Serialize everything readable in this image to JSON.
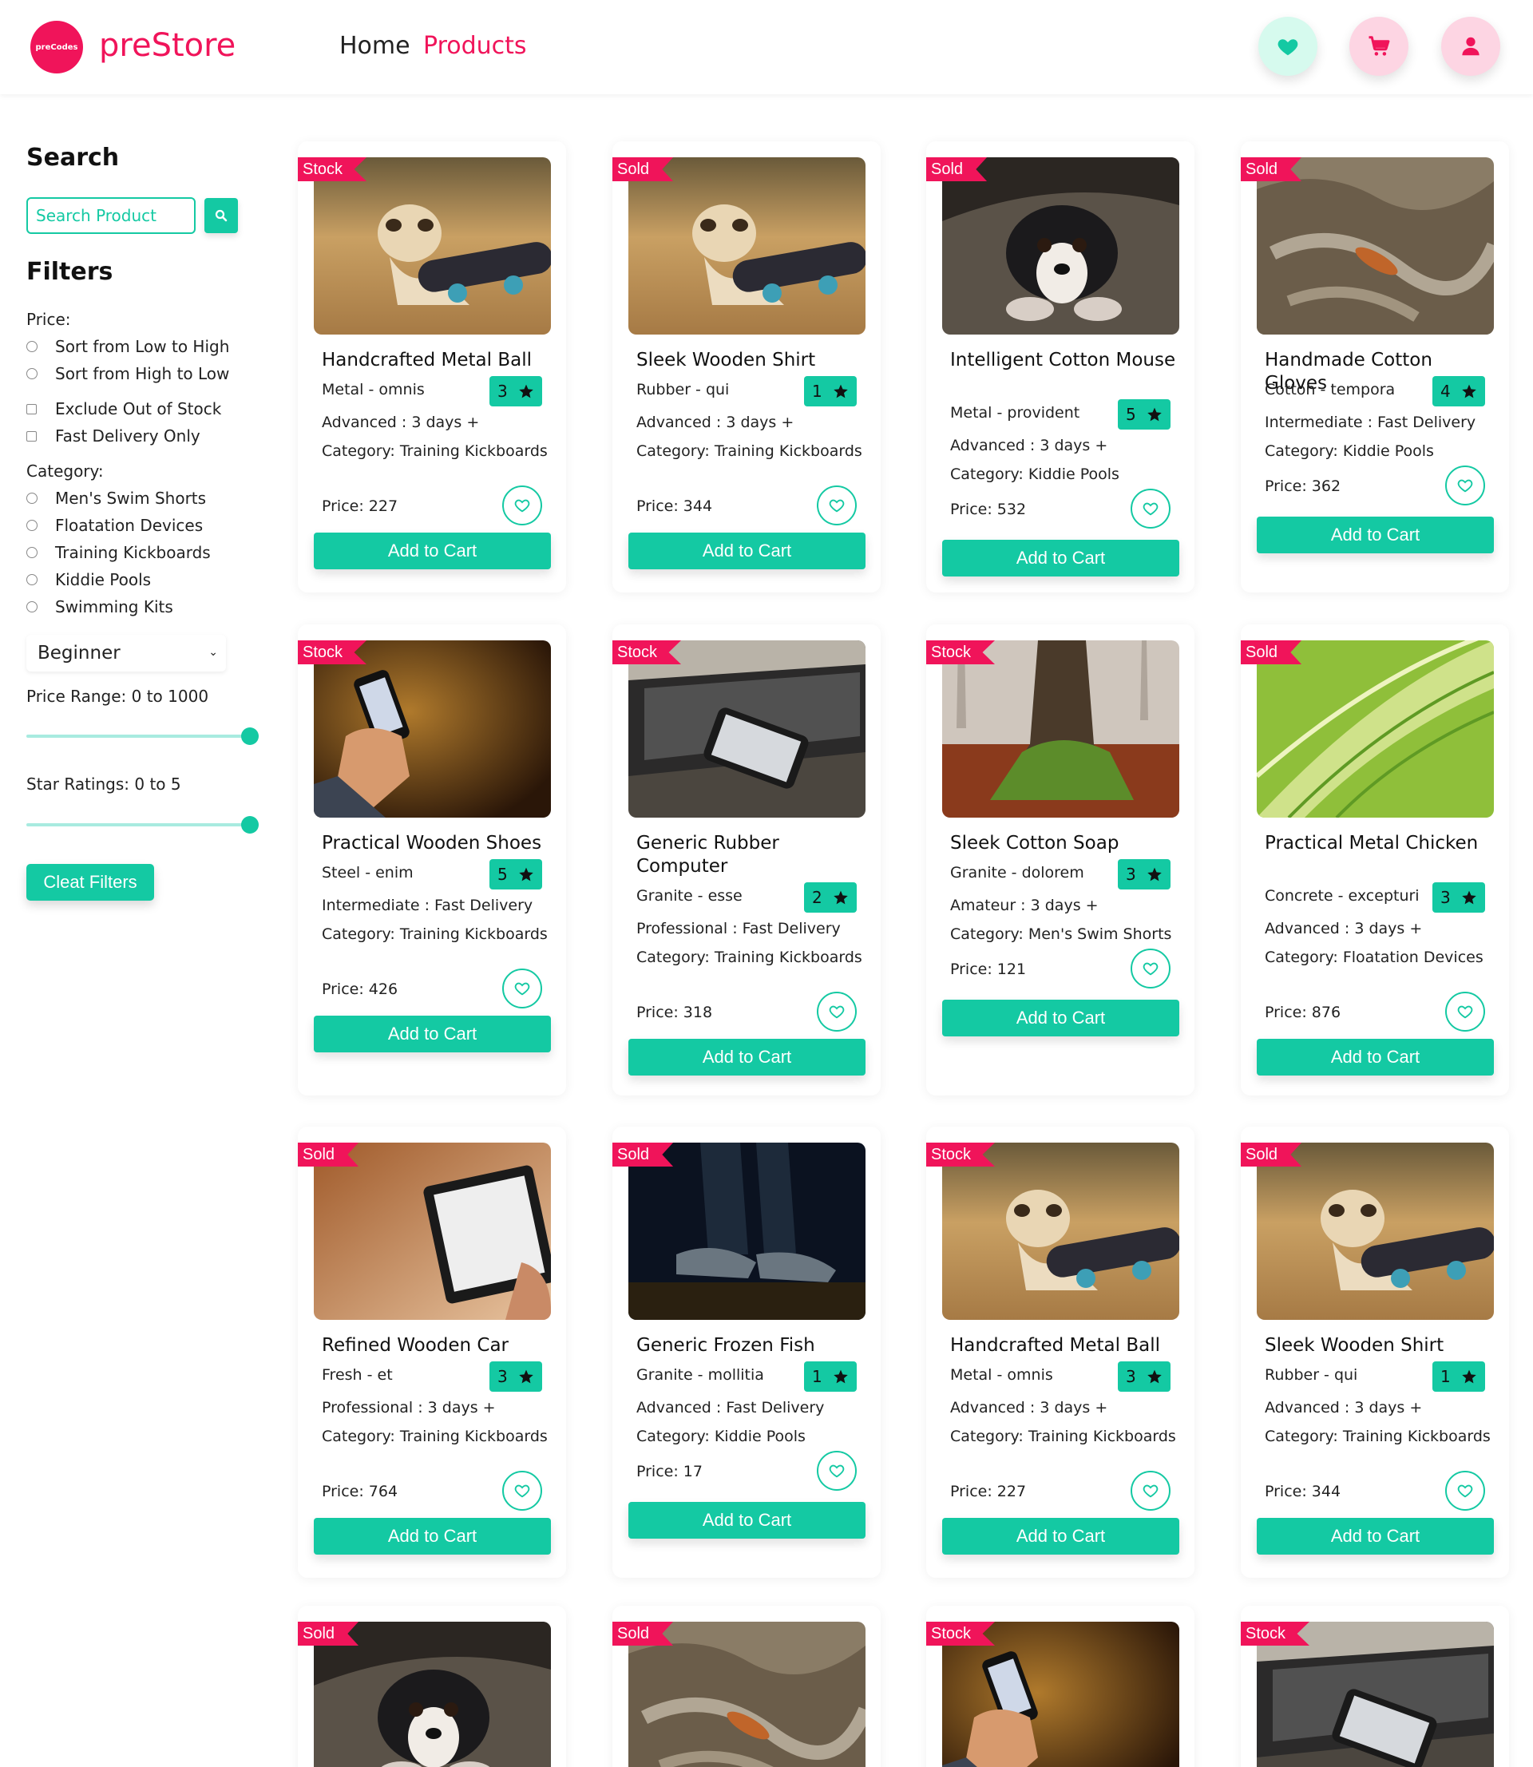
{
  "header": {
    "logo_badge": "preCodes",
    "brand": "preStore",
    "nav": {
      "home": "Home",
      "products": "Products"
    },
    "icons": [
      "heart-icon",
      "cart-icon",
      "user-icon"
    ],
    "colors": {
      "brand": "#f0145a",
      "accent": "#14c9a3"
    }
  },
  "sidebar": {
    "search_title": "Search",
    "search_placeholder": "Search Product",
    "filters_title": "Filters",
    "price_label": "Price:",
    "sort_options": [
      "Sort from Low to High",
      "Sort from High to Low"
    ],
    "checkboxes": [
      "Exclude Out of Stock",
      "Fast Delivery Only"
    ],
    "category_label": "Category:",
    "categories": [
      "Men's Swim Shorts",
      "Floatation Devices",
      "Training Kickboards",
      "Kiddie Pools",
      "Swimming Kits"
    ],
    "level_select": "Beginner",
    "price_range": "Price Range: 0 to 1000",
    "price_range_value": 1.0,
    "star_ratings": "Star Ratings: 0 to 5",
    "star_ratings_value": 1.0,
    "clear_button": "Cleat Filters"
  },
  "products": [
    {
      "badge": "Stock",
      "name": "Handcrafted Metal Ball",
      "material": "Metal - omnis",
      "rating": "3",
      "delivery": "Advanced : 3 days +",
      "category": "Category: Training Kickboards",
      "price": "Price: 227",
      "cart": "Add to Cart",
      "image": "dog"
    },
    {
      "badge": "Sold",
      "name": "Sleek Wooden Shirt",
      "material": "Rubber - qui",
      "rating": "1",
      "delivery": "Advanced : 3 days +",
      "category": "Category: Training Kickboards",
      "price": "Price: 344",
      "cart": "Add to Cart",
      "image": "dog"
    },
    {
      "badge": "Sold",
      "name": "Intelligent Cotton Mouse",
      "material": "Metal - provident",
      "rating": "5",
      "delivery": "Advanced : 3 days +",
      "category": "Category: Kiddie Pools",
      "price": "Price: 532",
      "cart": "Add to Cart",
      "image": "puppy"
    },
    {
      "badge": "Sold",
      "name": "Handmade Cotton Gloves",
      "material": "Cotton - tempora",
      "rating": "4",
      "delivery": "Intermediate : Fast Delivery",
      "category": "Category: Kiddie Pools",
      "price": "Price: 362",
      "cart": "Add to Cart",
      "image": "rock"
    },
    {
      "badge": "Stock",
      "name": "Practical Wooden Shoes",
      "material": "Steel - enim",
      "rating": "5",
      "delivery": "Intermediate : Fast Delivery",
      "category": "Category: Training Kickboards",
      "price": "Price: 426",
      "cart": "Add to Cart",
      "image": "phone"
    },
    {
      "badge": "Stock",
      "name": "Generic Rubber Computer",
      "material": "Granite - esse",
      "rating": "2",
      "delivery": "Professional : Fast Delivery",
      "category": "Category: Training Kickboards",
      "price": "Price: 318",
      "cart": "Add to Cart",
      "image": "laptop"
    },
    {
      "badge": "Stock",
      "name": "Sleek Cotton Soap",
      "material": "Granite - dolorem",
      "rating": "3",
      "delivery": "Amateur : 3 days +",
      "category": "Category: Men's Swim Shorts",
      "price": "Price: 121",
      "cart": "Add to Cart",
      "image": "tree"
    },
    {
      "badge": "Sold",
      "name": "Practical Metal Chicken",
      "material": "Concrete - excepturi",
      "rating": "3",
      "delivery": "Advanced : 3 days +",
      "category": "Category: Floatation Devices",
      "price": "Price: 876",
      "cart": "Add to Cart",
      "image": "leaf"
    },
    {
      "badge": "Sold",
      "name": "Refined Wooden Car",
      "material": "Fresh - et",
      "rating": "3",
      "delivery": "Professional : 3 days +",
      "category": "Category: Training Kickboards",
      "price": "Price: 764",
      "cart": "Add to Cart",
      "image": "tablet"
    },
    {
      "badge": "Sold",
      "name": "Generic Frozen Fish",
      "material": "Granite - mollitia",
      "rating": "1",
      "delivery": "Advanced : Fast Delivery",
      "category": "Category: Kiddie Pools",
      "price": "Price: 17",
      "cart": "Add to Cart",
      "image": "shoes"
    },
    {
      "badge": "Stock",
      "name": "Handcrafted Metal Ball",
      "material": "Metal - omnis",
      "rating": "3",
      "delivery": "Advanced : 3 days +",
      "category": "Category: Training Kickboards",
      "price": "Price: 227",
      "cart": "Add to Cart",
      "image": "dog"
    },
    {
      "badge": "Sold",
      "name": "Sleek Wooden Shirt",
      "material": "Rubber - qui",
      "rating": "1",
      "delivery": "Advanced : 3 days +",
      "category": "Category: Training Kickboards",
      "price": "Price: 344",
      "cart": "Add to Cart",
      "image": "dog"
    },
    {
      "badge": "Sold",
      "image": "puppy"
    },
    {
      "badge": "Sold",
      "image": "rock"
    },
    {
      "badge": "Stock",
      "image": "phone"
    },
    {
      "badge": "Stock",
      "image": "laptop"
    }
  ]
}
